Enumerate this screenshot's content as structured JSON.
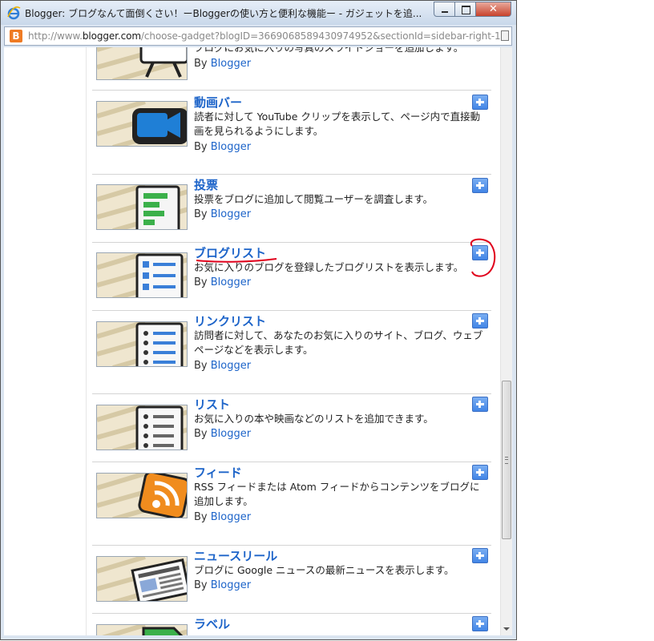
{
  "window": {
    "title": "Blogger: ブログなんて面倒くさい！ーBloggerの使い方と便利な機能ー - ガジェットを追...",
    "close_glyph": "✕"
  },
  "address": {
    "prefix": "http://www.",
    "domain": "blogger.com",
    "rest": "/choose-gadget?blogID=3669068589430974952&sectionId=sidebar-right-1"
  },
  "partial_top": {
    "desc": "ブログにお気に入りの写真のスライドショーを追加します。",
    "by": "By",
    "author": "Blogger"
  },
  "gadgets": [
    {
      "title": "動画バー",
      "desc": "読者に対して YouTube クリップを表示して、ページ内で直接動画を見られるようにします。",
      "by": "By",
      "author": "Blogger",
      "icon": "video-camera-icon"
    },
    {
      "title": "投票",
      "desc": "投票をブログに追加して閲覧ユーザーを調査します。",
      "by": "By",
      "author": "Blogger",
      "icon": "poll-icon"
    },
    {
      "title": "ブログリスト",
      "desc": "お気に入りのブログを登録したブログリストを表示します。",
      "by": "By",
      "author": "Blogger",
      "icon": "blog-list-icon"
    },
    {
      "title": "リンクリスト",
      "desc": "訪問者に対して、あなたのお気に入りのサイト、ブログ、ウェブページなどを表示します。",
      "by": "By",
      "author": "Blogger",
      "icon": "link-list-icon"
    },
    {
      "title": "リスト",
      "desc": "お気に入りの本や映画などのリストを追加できます。",
      "by": "By",
      "author": "Blogger",
      "icon": "list-icon"
    },
    {
      "title": "フィード",
      "desc": "RSS フィードまたは Atom フィードからコンテンツをブログに追加します。",
      "by": "By",
      "author": "Blogger",
      "icon": "rss-feed-icon"
    },
    {
      "title": "ニュースリール",
      "desc": "ブログに Google ニュースの最新ニュースを表示します。",
      "by": "By",
      "author": "Blogger",
      "icon": "newspaper-icon"
    },
    {
      "title": "ラベル",
      "desc": "",
      "by": "",
      "author": "",
      "icon": "label-tag-icon"
    }
  ],
  "colors": {
    "link": "#1d64c9",
    "add_button": "#4285e6",
    "annotation": "#e0001b"
  }
}
